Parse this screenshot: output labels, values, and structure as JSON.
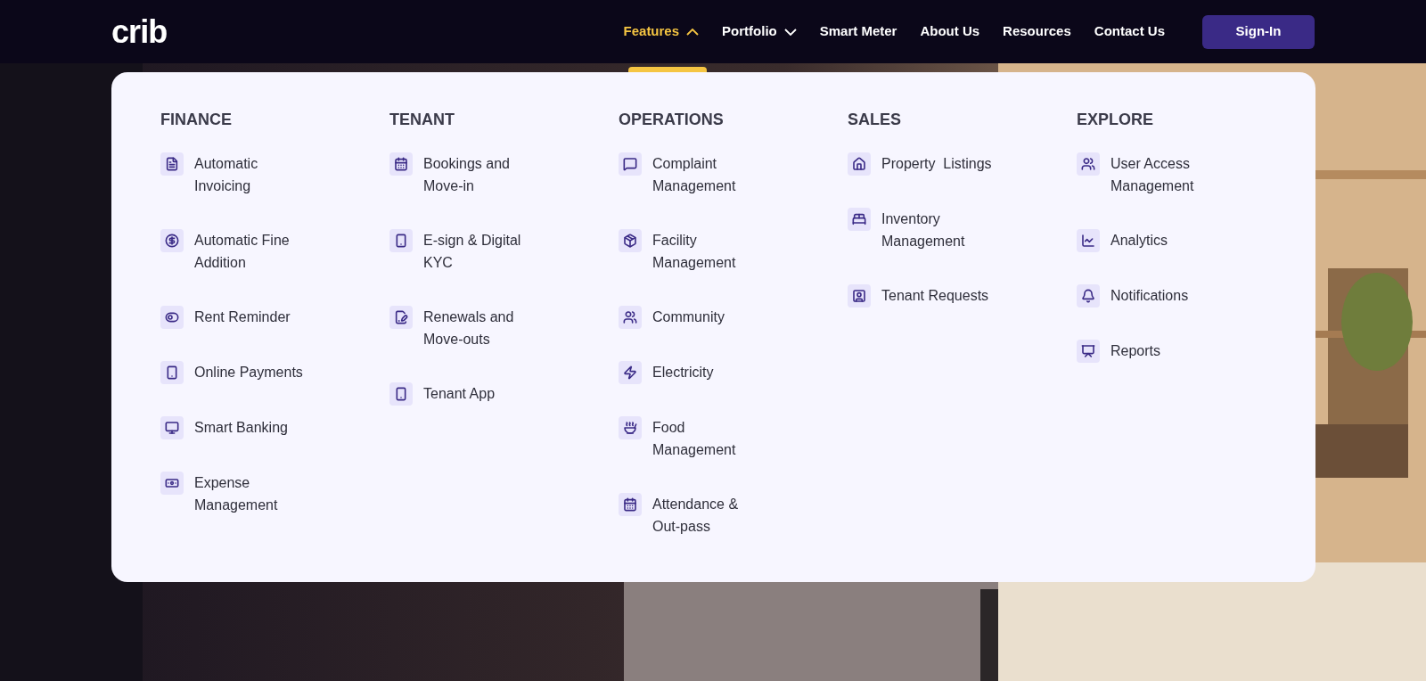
{
  "logo": "crib",
  "nav": [
    {
      "label": "Features",
      "kind": "dropdown",
      "selected": true,
      "expanded": true
    },
    {
      "label": "Portfolio",
      "kind": "dropdown",
      "selected": false,
      "expanded": false
    },
    {
      "label": "Smart Meter",
      "kind": "link",
      "selected": false
    },
    {
      "label": "About Us",
      "kind": "link",
      "selected": false
    },
    {
      "label": "Resources",
      "kind": "link",
      "selected": false
    },
    {
      "label": "Contact Us",
      "kind": "link",
      "selected": false
    }
  ],
  "sign_in": "Sign-In",
  "menu": [
    {
      "heading": "FINANCE",
      "items": [
        "Automatic Invoicing",
        "Automatic Fine Addition",
        "Rent Reminder",
        "Online Payments",
        "Smart Banking",
        "Expense Management"
      ]
    },
    {
      "heading": "TENANT",
      "items": [
        "Bookings and Move-in",
        "E-sign & Digital KYC",
        "Renewals and Move-outs",
        "Tenant App"
      ]
    },
    {
      "heading": "OPERATIONS",
      "items": [
        "Complaint Management",
        "Facility Management",
        "Community",
        "Electricity",
        "Food Management",
        "Attendance & Out-pass"
      ]
    },
    {
      "heading": "SALES",
      "items": [
        "Property  Listings",
        "Inventory Management",
        "Tenant Requests"
      ]
    },
    {
      "heading": "EXPLORE",
      "items": [
        "User Access Management",
        "Analytics",
        "Notifications",
        "Reports"
      ]
    }
  ]
}
